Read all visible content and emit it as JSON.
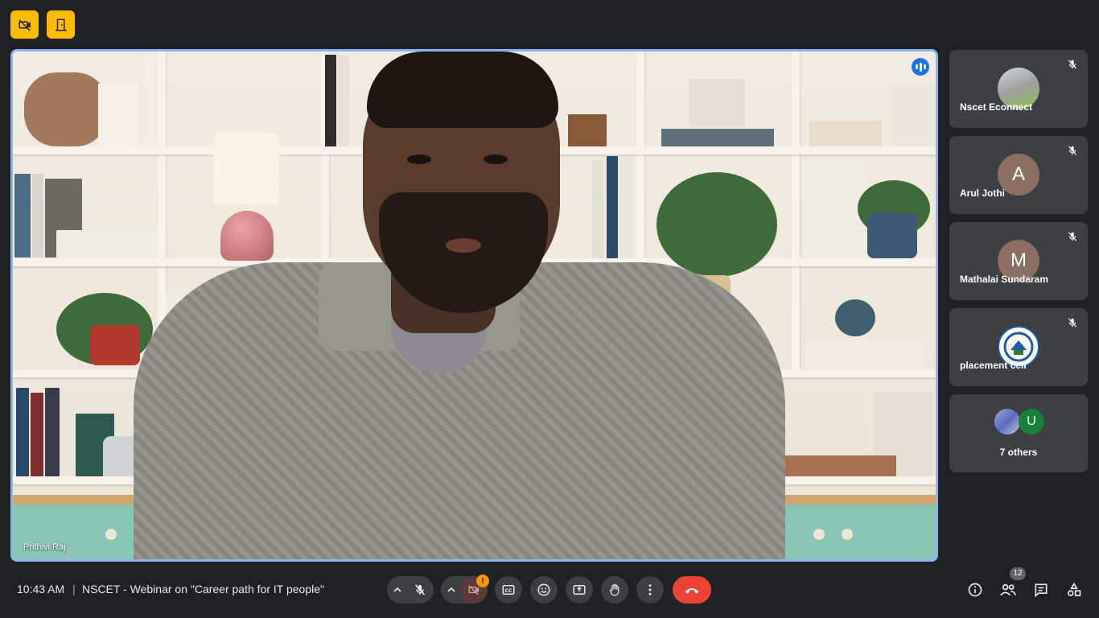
{
  "topbar": {
    "buttons": [
      {
        "icon": "camera-off-icon"
      },
      {
        "icon": "door-exit-icon"
      }
    ]
  },
  "stage": {
    "speaker_name": "Prithivi Raj",
    "speaking_indicator": "audio-bars-icon"
  },
  "participants": [
    {
      "name": "Nscet Econnect",
      "avatar": "image",
      "muted": true
    },
    {
      "name": "Arul Jothi",
      "avatar_letter": "A",
      "avatar_color": "#8d6e63",
      "muted": true
    },
    {
      "name": "Mathalai Sundaram",
      "avatar_letter": "M",
      "avatar_color": "#8d6e63",
      "muted": true
    },
    {
      "name": "placement cell",
      "avatar": "logo",
      "muted": true
    }
  ],
  "others": {
    "label": "7 others",
    "avatar_letter": "U",
    "avatar_color": "#188038"
  },
  "bottombar": {
    "time": "10:43 AM",
    "separator": "|",
    "meeting_title": "NSCET - Webinar on \"Career path for IT people\"",
    "camera_alert_badge": "!",
    "people_count": "12"
  },
  "colors": {
    "background": "#202124",
    "accent_blue": "#8ab4f8",
    "danger_red": "#ea4335",
    "warning_yellow": "#fbbc04"
  }
}
